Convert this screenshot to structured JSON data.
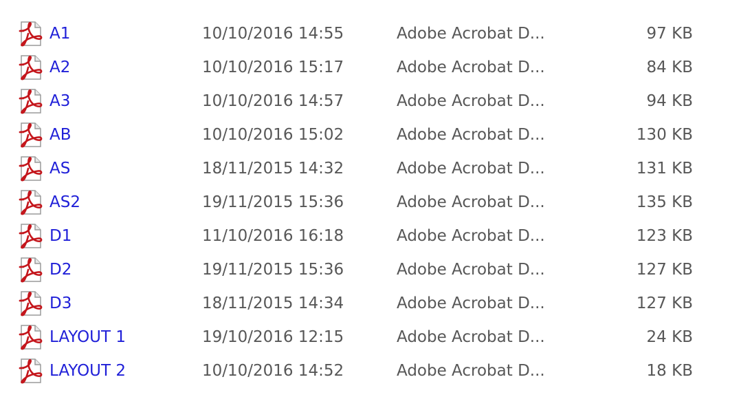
{
  "files": [
    {
      "name": "A1",
      "date_modified": "10/10/2016 14:55",
      "type": "Adobe Acrobat D...",
      "size": "97 KB",
      "icon": "pdf-icon"
    },
    {
      "name": "A2",
      "date_modified": "10/10/2016 15:17",
      "type": "Adobe Acrobat D...",
      "size": "84 KB",
      "icon": "pdf-icon"
    },
    {
      "name": "A3",
      "date_modified": "10/10/2016 14:57",
      "type": "Adobe Acrobat D...",
      "size": "94 KB",
      "icon": "pdf-icon"
    },
    {
      "name": "AB",
      "date_modified": "10/10/2016 15:02",
      "type": "Adobe Acrobat D...",
      "size": "130 KB",
      "icon": "pdf-icon"
    },
    {
      "name": "AS",
      "date_modified": "18/11/2015 14:32",
      "type": "Adobe Acrobat D...",
      "size": "131 KB",
      "icon": "pdf-icon"
    },
    {
      "name": "AS2",
      "date_modified": "19/11/2015 15:36",
      "type": "Adobe Acrobat D...",
      "size": "135 KB",
      "icon": "pdf-icon"
    },
    {
      "name": "D1",
      "date_modified": "11/10/2016 16:18",
      "type": "Adobe Acrobat D...",
      "size": "123 KB",
      "icon": "pdf-icon"
    },
    {
      "name": "D2",
      "date_modified": "19/11/2015 15:36",
      "type": "Adobe Acrobat D...",
      "size": "127 KB",
      "icon": "pdf-icon"
    },
    {
      "name": "D3",
      "date_modified": "18/11/2015 14:34",
      "type": "Adobe Acrobat D...",
      "size": "127 KB",
      "icon": "pdf-icon"
    },
    {
      "name": "LAYOUT 1",
      "date_modified": "19/10/2016 12:15",
      "type": "Adobe Acrobat D...",
      "size": "24 KB",
      "icon": "pdf-icon"
    },
    {
      "name": "LAYOUT 2",
      "date_modified": "10/10/2016 14:52",
      "type": "Adobe Acrobat D...",
      "size": "18 KB",
      "icon": "pdf-icon"
    }
  ],
  "colors": {
    "name_text": "#1f1fd8",
    "detail_text": "#575757",
    "pdf_icon_red": "#c4161c"
  }
}
